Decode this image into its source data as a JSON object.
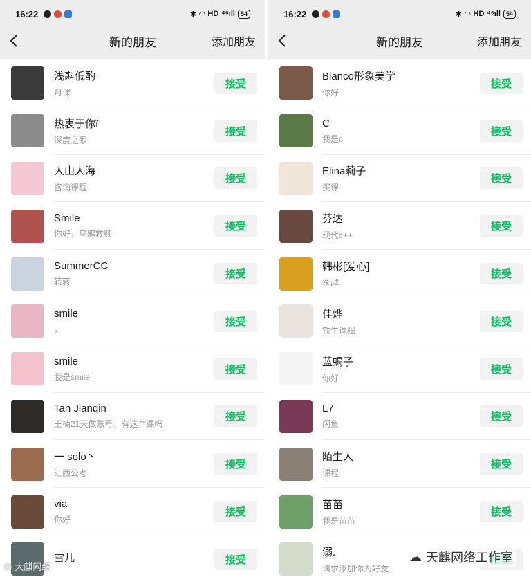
{
  "left_screen": {
    "status": {
      "time": "16:22",
      "network": "HD",
      "signal": "⁴⁶ıll",
      "battery": "54"
    },
    "nav": {
      "title": "新的朋友",
      "action": "添加朋友"
    },
    "accept_label": "接受",
    "rows": [
      {
        "name": "浅斟低酌",
        "msg": "月课",
        "avatar_color": "#3a3a3a"
      },
      {
        "name": "热衷于你ĩ",
        "msg": "深度之眼",
        "avatar_color": "#8c8c8c"
      },
      {
        "name": "人山人海",
        "msg": "咨询课程",
        "avatar_color": "#f6c8d6"
      },
      {
        "name": "Smile",
        "msg": "你好，乌鸦救赎",
        "avatar_color": "#b0524e"
      },
      {
        "name": "SummerCC",
        "msg": "转转",
        "avatar_color": "#c9d4df"
      },
      {
        "name": "smile",
        "msg": "，",
        "avatar_color": "#e8b6c4"
      },
      {
        "name": "smile",
        "msg": "我是smile",
        "avatar_color": "#f3c2cc"
      },
      {
        "name": "Tan Jianqin",
        "msg": "王楠21天做账号，有这个课吗",
        "avatar_color": "#2e2a28"
      },
      {
        "name": "一 solo丶",
        "msg": "江西公考",
        "avatar_color": "#9b6b4f"
      },
      {
        "name": "via",
        "msg": "你好",
        "avatar_color": "#6a4b3a"
      },
      {
        "name": "雪儿",
        "msg": "",
        "avatar_color": "#5b6b6b"
      }
    ]
  },
  "right_screen": {
    "status": {
      "time": "16:22",
      "network": "HD",
      "signal": "⁴⁶ıll",
      "battery": "54"
    },
    "nav": {
      "title": "新的朋友",
      "action": "添加朋友"
    },
    "accept_label": "接受",
    "rows": [
      {
        "name": "Blanco形象美学",
        "msg": "你好",
        "avatar_color": "#7c5a48"
      },
      {
        "name": "C",
        "msg": "我是c",
        "avatar_color": "#5b7a48"
      },
      {
        "name": "Elina莉子",
        "msg": "买课",
        "avatar_color": "#f0e6da"
      },
      {
        "name": "芬达",
        "msg": "现代c++",
        "avatar_color": "#6a4a40"
      },
      {
        "name": "韩彬[爱心]",
        "msg": "李越",
        "avatar_color": "#d9a01f"
      },
      {
        "name": "佳烨",
        "msg": "铁牛课程",
        "avatar_color": "#e9e4e0"
      },
      {
        "name": "蓝蝎子",
        "msg": "你好",
        "avatar_color": "#f4f4f4"
      },
      {
        "name": "L7",
        "msg": "闲鱼",
        "avatar_color": "#7a3a56"
      },
      {
        "name": "陌生人",
        "msg": "课程",
        "avatar_color": "#8a8075"
      },
      {
        "name": "苗苗",
        "msg": "我是苗苗",
        "avatar_color": "#6fa06a"
      },
      {
        "name": "溺.",
        "msg": "请求添加你为好友",
        "avatar_color": "#d6dccc"
      }
    ]
  },
  "watermarks": {
    "left": "大麒网络",
    "right": "天麒网络工作室"
  },
  "colors": {
    "accept_text": "#07c160",
    "accept_bg": "#f2f2f2",
    "page_bg": "#ededed"
  }
}
